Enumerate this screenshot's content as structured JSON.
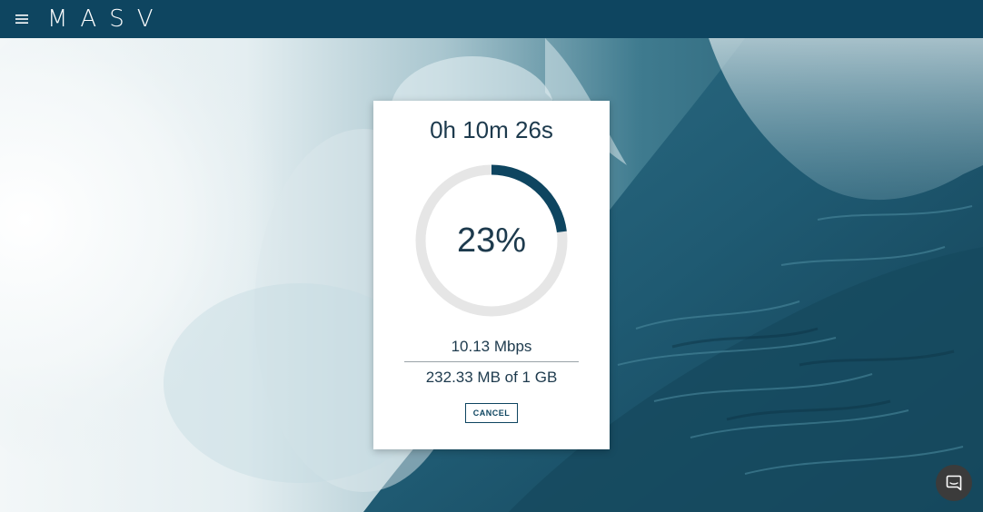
{
  "header": {
    "logo_text": "MASV",
    "menu_icon": "hamburger-menu-icon",
    "background_color": "#0e4560"
  },
  "transfer": {
    "elapsed_time": "0h 10m 26s",
    "progress_percent_label": "23%",
    "progress_fraction": 0.23,
    "speed": "10.13 Mbps",
    "transferred": "232.33 MB of 1 GB",
    "cancel_label": "CANCEL",
    "ring_color": "#0e4560",
    "ring_track_color": "#e6e6e6"
  },
  "chat": {
    "icon": "chat-bubble-icon"
  }
}
